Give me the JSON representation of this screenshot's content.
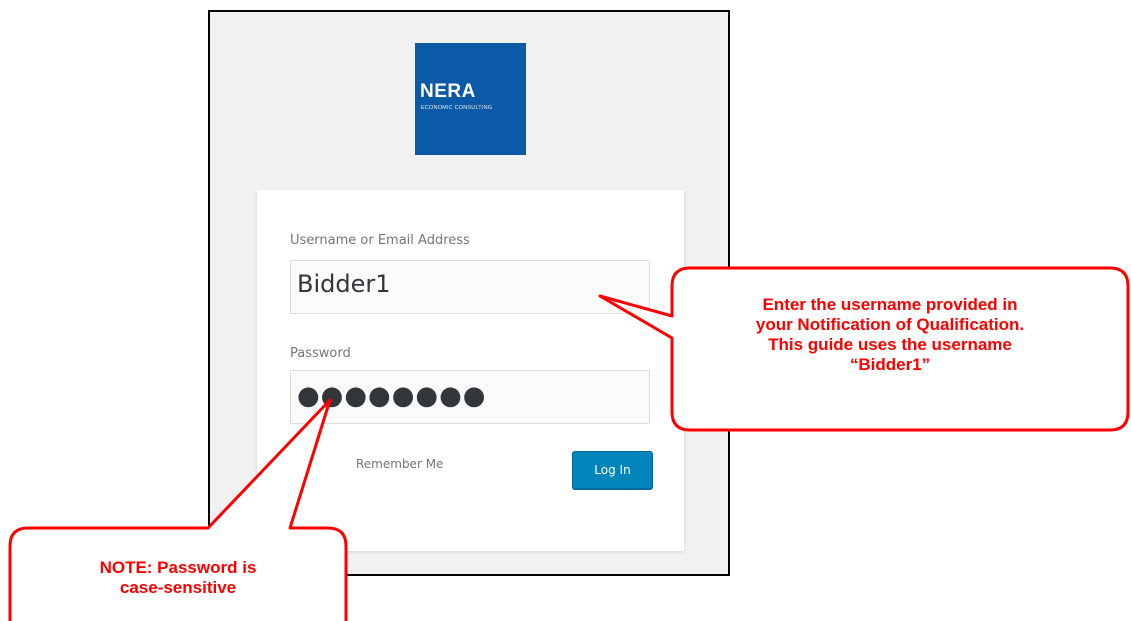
{
  "logo": {
    "name": "NERA",
    "tagline": "ECONOMIC CONSULTING",
    "brand_color": "#0a5aa8"
  },
  "login_form": {
    "username_label": "Username or Email Address",
    "username_value": "Bidder1",
    "password_label": "Password",
    "password_mask": "●●●●●●●●",
    "remember_label": "Remember Me",
    "login_button": "Log In",
    "button_color": "#0085ba"
  },
  "callouts": {
    "username": {
      "line1": "Enter the username provided in",
      "line2": "your Notification of Qualification.",
      "line3": "This guide uses the username",
      "line4": "“Bidder1”"
    },
    "password": {
      "line1": "NOTE:  Password is",
      "line2": "case-sensitive"
    },
    "color": "#ff0000"
  }
}
